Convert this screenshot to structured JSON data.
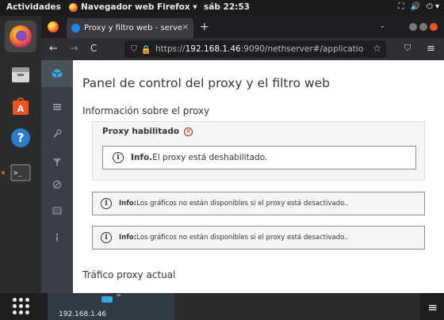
{
  "topbar": {
    "activities": "Actividades",
    "app_name": "Navegador web Firefox ▾",
    "clock": "sáb 22:53",
    "tray": [
      "⛶",
      "🔊",
      "⏻ ▾"
    ]
  },
  "dock": {
    "items": [
      "firefox-icon",
      "files-icon",
      "software-icon",
      "help-icon",
      "terminal-icon"
    ]
  },
  "browser": {
    "tab_title": "Proxy y filtro web - serve",
    "tab_close": "×",
    "new_tab": "+",
    "list_tabs": "⌄",
    "back": "←",
    "forward": "→",
    "reload": "C",
    "url_prefix": "https://",
    "url_host": "192.168.1.46",
    "url_rest": ":9090/nethserver#/applicatio",
    "bookmark_star": "☆",
    "pocket": "⛉",
    "menu": "≡"
  },
  "sidenav": {
    "items": [
      "cube-icon",
      "list-icon",
      "wrench-icon",
      "filter-icon",
      "ban-icon",
      "table-icon",
      "info-icon"
    ]
  },
  "content": {
    "title": "Panel de control del proxy y el filtro web",
    "section_info": "Información sobre el proxy",
    "proxy_status_label": "Proxy habilitado",
    "alert_disabled_bold": "Info.",
    "alert_disabled_text": " El proxy está deshabilitado.",
    "alert_graphs_bold": "Info:",
    "alert_graphs_text": " Los gráficos no están disponibles si el proxy está desactivado..",
    "section_traffic": "Tráfico proxy actual"
  },
  "bottom": {
    "host_label": "192.168.1.46",
    "menu": "≡"
  },
  "colors": {
    "accent": "#e95420",
    "cockpit_blue": "#39a5dc",
    "error_red": "#c9190b"
  }
}
